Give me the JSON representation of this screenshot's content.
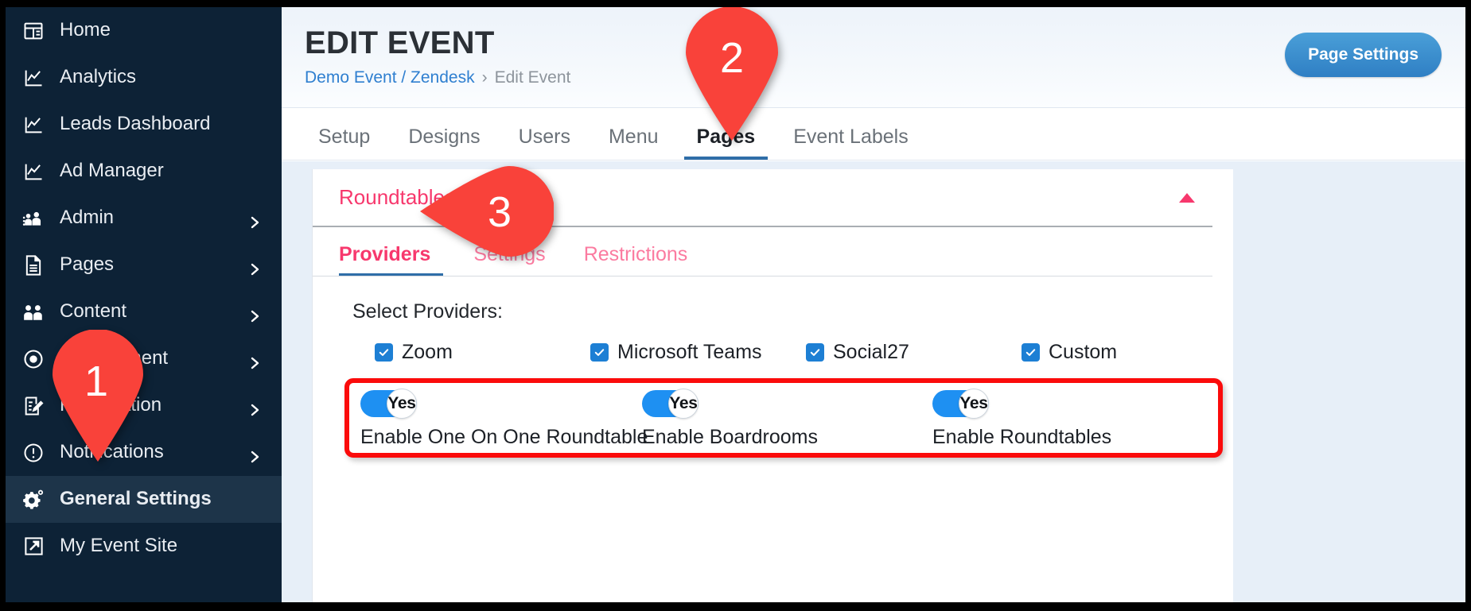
{
  "sidebar": {
    "items": [
      {
        "label": "Home",
        "icon": "dashboard-icon",
        "chevron": false,
        "active": false
      },
      {
        "label": "Analytics",
        "icon": "chart-icon",
        "chevron": false,
        "active": false
      },
      {
        "label": "Leads Dashboard",
        "icon": "chart-icon",
        "chevron": false,
        "active": false
      },
      {
        "label": "Ad Manager",
        "icon": "chart-icon",
        "chevron": false,
        "active": false
      },
      {
        "label": "Admin",
        "icon": "people-icon",
        "chevron": true,
        "active": false
      },
      {
        "label": "Pages",
        "icon": "document-icon",
        "chevron": true,
        "active": false
      },
      {
        "label": "Content",
        "icon": "users-icon",
        "chevron": true,
        "active": false
      },
      {
        "label": "Engagement",
        "icon": "radio-dot-icon",
        "chevron": true,
        "active": false
      },
      {
        "label": "Registration",
        "icon": "form-edit-icon",
        "chevron": true,
        "active": false
      },
      {
        "label": "Notifications",
        "icon": "alert-icon",
        "chevron": true,
        "active": false
      },
      {
        "label": "General Settings",
        "icon": "gear-icon",
        "chevron": false,
        "active": true
      },
      {
        "label": "My Event Site",
        "icon": "external-link-icon",
        "chevron": false,
        "active": false
      }
    ]
  },
  "header": {
    "title": "EDIT EVENT",
    "breadcrumb": {
      "link": "Demo Event / Zendesk",
      "separator": "›",
      "current": "Edit Event"
    },
    "page_settings_button": "Page Settings"
  },
  "top_tabs": [
    {
      "label": "Setup",
      "active": false
    },
    {
      "label": "Designs",
      "active": false
    },
    {
      "label": "Users",
      "active": false
    },
    {
      "label": "Menu",
      "active": false
    },
    {
      "label": "Pages",
      "active": true
    },
    {
      "label": "Event Labels",
      "active": false
    }
  ],
  "panel": {
    "title": "Roundtables",
    "collapse_icon": "caret-up-icon",
    "sub_tabs": [
      {
        "label": "Providers",
        "active": true
      },
      {
        "label": "Settings",
        "active": false
      },
      {
        "label": "Restrictions",
        "active": false
      }
    ],
    "select_providers_label": "Select Providers:",
    "providers": [
      {
        "label": "Zoom",
        "checked": true
      },
      {
        "label": "Microsoft Teams",
        "checked": true
      },
      {
        "label": "Social27",
        "checked": true
      },
      {
        "label": "Custom",
        "checked": true
      }
    ],
    "toggles": [
      {
        "label": "Enable One On One Roundtable",
        "state": "Yes",
        "on": true
      },
      {
        "label": "Enable Boardrooms",
        "state": "Yes",
        "on": true
      },
      {
        "label": "Enable Roundtables",
        "state": "Yes",
        "on": true
      }
    ]
  },
  "annotations": {
    "markers": [
      {
        "number": "1",
        "points_to": "General Settings"
      },
      {
        "number": "2",
        "points_to": "Pages tab"
      },
      {
        "number": "3",
        "points_to": "Roundtables panel"
      }
    ],
    "highlight_box_color": "#fb0b0b"
  },
  "colors": {
    "sidebar_bg": "#0d2236",
    "accent_pink": "#f7386d",
    "accent_blue": "#2f7fc4",
    "checkbox_blue": "#1d7fd4",
    "toggle_blue": "#1e90f2",
    "marker_red": "#f9423a",
    "content_bg": "#e7eff8"
  }
}
